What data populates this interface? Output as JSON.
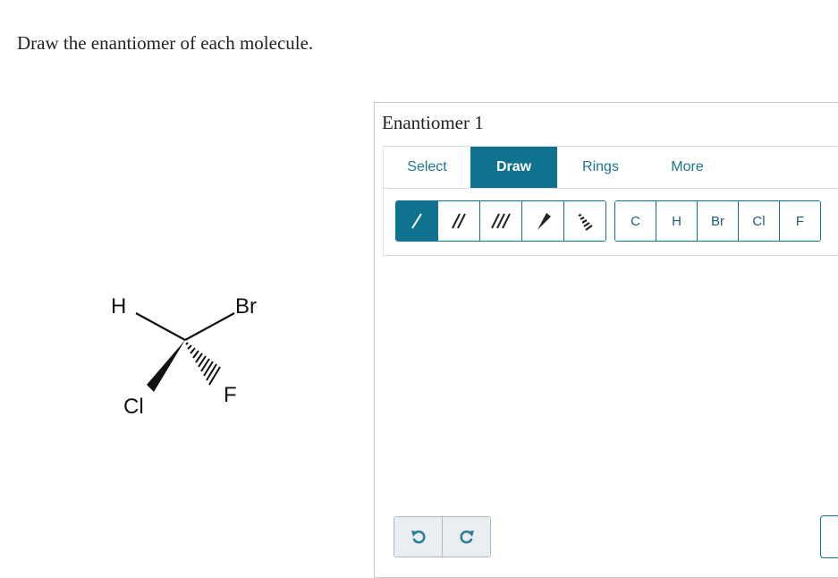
{
  "prompt": "Draw the enantiomer of each molecule.",
  "molecule": {
    "atoms": {
      "h": "H",
      "br": "Br",
      "cl": "Cl",
      "f": "F"
    }
  },
  "panel": {
    "title": "Enantiomer 1",
    "tabs": [
      {
        "label": "Select"
      },
      {
        "label": "Draw"
      },
      {
        "label": "Rings"
      },
      {
        "label": "More"
      }
    ],
    "active_tab": "Draw",
    "bond_tools": [
      "single-bond-icon",
      "double-bond-icon",
      "triple-bond-icon",
      "wedge-bond-icon",
      "hash-bond-icon"
    ],
    "atoms": [
      "C",
      "H",
      "Br",
      "Cl",
      "F"
    ],
    "history": [
      "undo-icon",
      "redo-icon"
    ]
  },
  "colors": {
    "accent": "#0f7390",
    "link": "#1c7690"
  }
}
